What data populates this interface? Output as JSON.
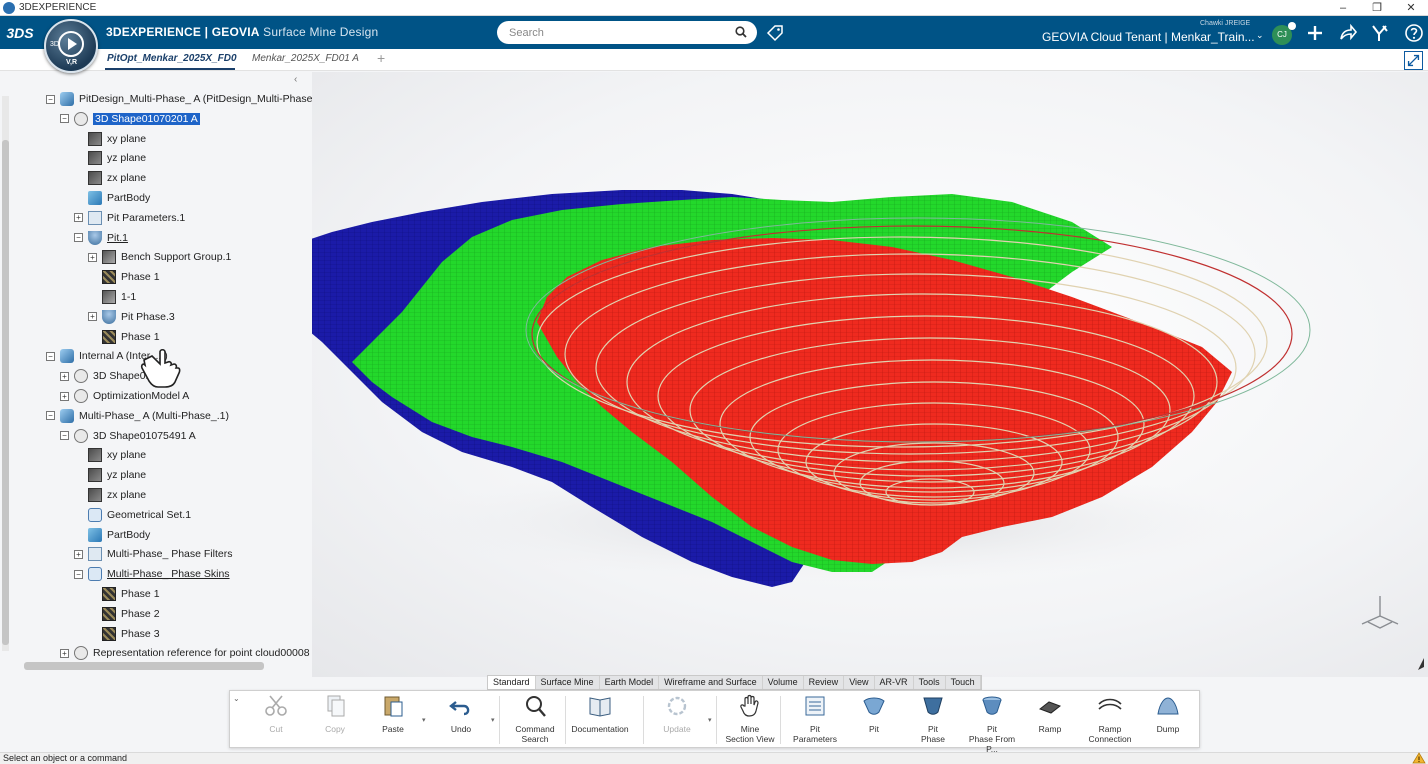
{
  "window": {
    "title": "3DEXPERIENCE",
    "minimize": "–",
    "restore": "❐",
    "close": "✕"
  },
  "topbar": {
    "brand_prefix": "3DEXPERIENCE | ",
    "brand_name": "GEOVIA",
    "app_name": " Surface Mine Design",
    "search_placeholder": "Search",
    "user_name": "Chawki JREIGE",
    "tenant": "GEOVIA Cloud Tenant | Menkar_Train...",
    "avatar_initials": "CJ",
    "compass_3d": "3D",
    "compass_vr": "V,R",
    "logo_text": "3DS"
  },
  "tabs": [
    {
      "label": "PitOpt_Menkar_2025X_FD0"
    },
    {
      "label": "Menkar_2025X_FD01 A"
    }
  ],
  "tab_add": "+",
  "tree_collapse": "‹",
  "tree": [
    {
      "label": "PitDesign_Multi-Phase_ A (PitDesign_Multi-Phase",
      "icon": "product",
      "exp": "−"
    },
    {
      "label": "3D Shape01070201 A",
      "icon": "shape",
      "exp": "−",
      "selected": true
    },
    {
      "label": "xy plane",
      "icon": "plane"
    },
    {
      "label": "yz plane",
      "icon": "plane"
    },
    {
      "label": "zx plane",
      "icon": "plane"
    },
    {
      "label": "PartBody",
      "icon": "body"
    },
    {
      "label": "Pit Parameters.1",
      "icon": "params",
      "exp": "+"
    },
    {
      "label": "Pit.1",
      "icon": "pit",
      "exp": "−",
      "underline": true
    },
    {
      "label": "Bench Support Group.1",
      "icon": "group",
      "exp": "+"
    },
    {
      "label": "Phase 1",
      "icon": "phase"
    },
    {
      "label": "1-1",
      "icon": "group"
    },
    {
      "label": "Pit Phase.3",
      "icon": "pit",
      "exp": "+"
    },
    {
      "label": "Phase 1",
      "icon": "phase"
    },
    {
      "label": "Internal A (Inter...1)",
      "icon": "product",
      "exp": "−"
    },
    {
      "label": "3D Shape01...0 A",
      "icon": "shape",
      "exp": "+"
    },
    {
      "label": "OptimizationModel A",
      "icon": "shape",
      "exp": "+"
    },
    {
      "label": "Multi-Phase_ A (Multi-Phase_.1)",
      "icon": "product",
      "exp": "−"
    },
    {
      "label": "3D Shape01075491 A",
      "icon": "shape",
      "exp": "−"
    },
    {
      "label": "xy plane",
      "icon": "plane"
    },
    {
      "label": "yz plane",
      "icon": "plane"
    },
    {
      "label": "zx plane",
      "icon": "plane"
    },
    {
      "label": "Geometrical Set.1",
      "icon": "set"
    },
    {
      "label": "PartBody",
      "icon": "body"
    },
    {
      "label": "Multi-Phase_ Phase Filters",
      "icon": "params",
      "exp": "+"
    },
    {
      "label": "Multi-Phase_ Phase Skins",
      "icon": "set",
      "exp": "−",
      "underline": true
    },
    {
      "label": "Phase 1",
      "icon": "phase"
    },
    {
      "label": "Phase 2",
      "icon": "phase"
    },
    {
      "label": "Phase 3",
      "icon": "phase"
    },
    {
      "label": "Representation reference for point cloud00008",
      "icon": "shape",
      "exp": "+"
    }
  ],
  "colors": {
    "top_bar": "#005386",
    "phase_outer": "#1a1aa6",
    "phase_middle": "#22d62a",
    "phase_inner": "#ee2a1f",
    "pit_lines": "#d8c9a5",
    "selection": "#1e64c8"
  },
  "command_tabs": [
    "Standard",
    "Surface Mine",
    "Earth Model",
    "Wireframe and Surface",
    "Volume",
    "Review",
    "View",
    "AR-VR",
    "Tools",
    "Touch"
  ],
  "tools": [
    {
      "label": "Cut",
      "icon": "scissors-icon",
      "disabled": true
    },
    {
      "label": "Copy",
      "icon": "copy-icon",
      "disabled": true
    },
    {
      "label": "Paste",
      "icon": "paste-icon"
    },
    {
      "label": "Undo",
      "icon": "undo-icon"
    },
    {
      "label": "Command\nSearch",
      "icon": "command-search-icon"
    },
    {
      "label": "Documentation",
      "icon": "book-icon"
    },
    {
      "label": "Update",
      "icon": "update-icon",
      "disabled": true
    },
    {
      "label": "Mine\nSection View",
      "icon": "hand-icon"
    },
    {
      "label": "Pit\nParameters",
      "icon": "pit-parameters-icon"
    },
    {
      "label": "Pit",
      "icon": "pit-icon"
    },
    {
      "label": "Pit\nPhase",
      "icon": "pit-phase-icon"
    },
    {
      "label": "Pit\nPhase From P...",
      "icon": "pit-phase-from-icon"
    },
    {
      "label": "Ramp",
      "icon": "ramp-icon"
    },
    {
      "label": "Ramp\nConnection",
      "icon": "ramp-connection-icon"
    },
    {
      "label": "Dump",
      "icon": "dump-icon"
    }
  ],
  "status": {
    "text": "Select an object or a command"
  }
}
